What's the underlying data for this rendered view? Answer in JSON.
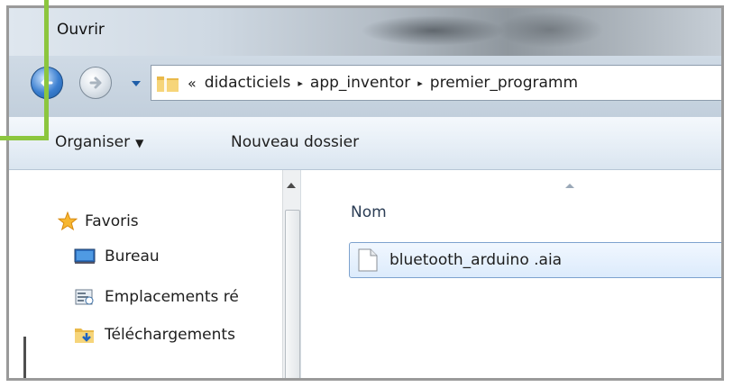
{
  "window": {
    "title": "Ouvrir"
  },
  "nav": {
    "back_icon": "back-arrow-icon",
    "forward_icon": "forward-arrow-icon",
    "history_icon": "chevron-down-icon"
  },
  "address": {
    "overflow": "«",
    "segments": [
      "didacticiels",
      "app_inventor",
      "premier_programm"
    ],
    "separator": "▸"
  },
  "toolbar": {
    "organize_label": "Organiser",
    "organize_caret": "▼",
    "new_folder_label": "Nouveau dossier"
  },
  "sidebar": {
    "favorites_label": "Favoris",
    "items": [
      {
        "label": "Bureau",
        "icon": "desktop-icon"
      },
      {
        "label": "Emplacements ré",
        "icon": "recent-places-icon"
      },
      {
        "label": "Téléchargements",
        "icon": "downloads-folder-icon"
      }
    ]
  },
  "content": {
    "column_header": "Nom",
    "files": [
      {
        "name": "bluetooth_arduino .aia",
        "icon": "file-icon",
        "selected": true
      }
    ]
  },
  "colors": {
    "highlight": "#8cc63e",
    "selection_border": "#7da2ce",
    "selection_fill": "#dcebfc",
    "title_text": "#111111"
  }
}
